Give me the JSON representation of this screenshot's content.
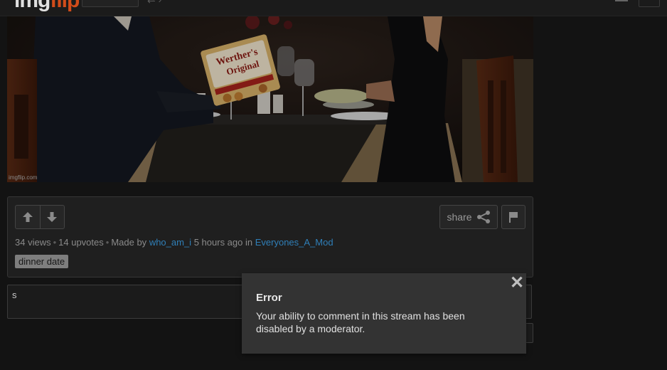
{
  "header": {
    "logo_part1": "img",
    "logo_part2": "flip"
  },
  "meme": {
    "watermark": "imgflip.com",
    "candy_brand_line1": "Werther's",
    "candy_brand_line2": "Original"
  },
  "post": {
    "views": "34 views",
    "upvotes": "14 upvotes",
    "made_by_label": "Made by",
    "author": "who_am_i",
    "time_ago": "5 hours ago in",
    "stream": "Everyones_A_Mod",
    "tag": "dinner date",
    "share_label": "share"
  },
  "comment": {
    "value": "s"
  },
  "popup": {
    "title": "Error",
    "message": "Your ability to comment in this stream has been disabled by a moderator.",
    "close_symbol": "✕"
  },
  "icons": {
    "upvote": "arrow-up-icon",
    "downvote": "arrow-down-icon",
    "share": "share-icon",
    "flag": "flag-icon",
    "close": "close-icon"
  },
  "colors": {
    "link": "#2f7fb8",
    "logo_accent": "#d24c1a",
    "popup_bg": "#333333"
  }
}
